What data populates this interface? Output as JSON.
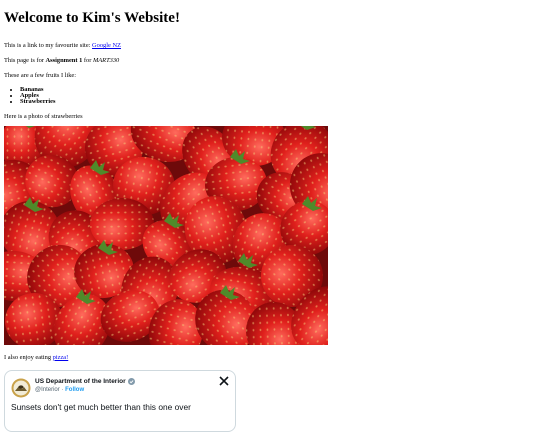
{
  "heading": "Welcome to Kim's Website!",
  "intro": {
    "text": "This is a link to my favourite site: ",
    "link": "Google NZ"
  },
  "assignment": {
    "pre": "This page is for ",
    "bold": "Assignment 1",
    "mid": " for ",
    "italic": "MART330"
  },
  "fruits_intro": "These are a few fruits I like:",
  "fruits": [
    "Bananas",
    "Apples",
    "Strawberries"
  ],
  "photo_caption": "Here is a photo of strawberries",
  "pizza": {
    "text": "I also enjoy eating ",
    "link": "pizza!"
  },
  "tweet": {
    "account_name": "US Department of the Interior",
    "handle": "@Interior",
    "separator": " · ",
    "follow": "Follow",
    "text": "Sunsets don't get much better than this one over",
    "icons": [
      "interior-seal-avatar",
      "verified-badge-icon",
      "x-logo-icon"
    ],
    "colors": {
      "follow": "#1d9bf0",
      "badge": "#829aab"
    }
  }
}
